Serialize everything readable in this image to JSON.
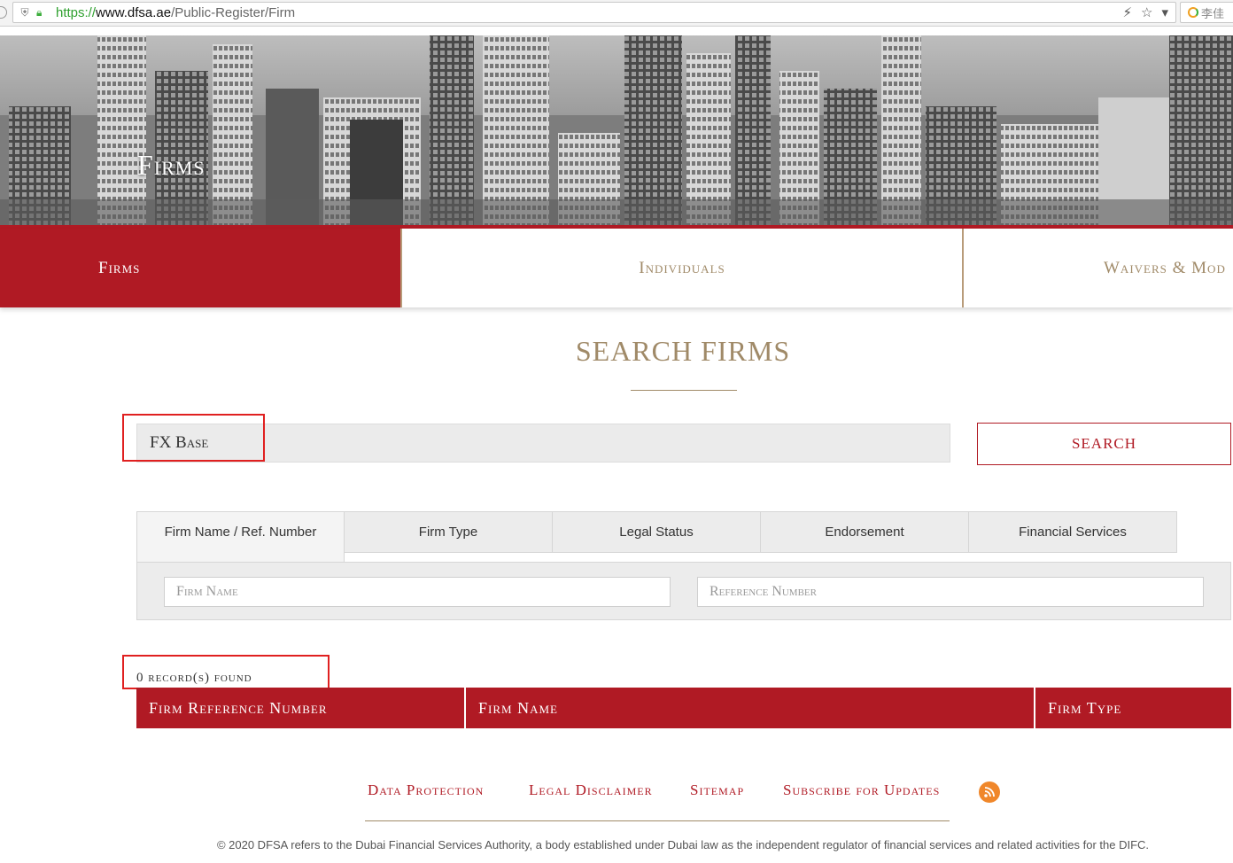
{
  "browser": {
    "url_scheme": "https://",
    "url_host": "www.dfsa.ae",
    "url_path": "/Public-Register/Firm",
    "profile_label": "李佳"
  },
  "hero": {
    "title": "Firms"
  },
  "category_tabs": [
    {
      "label": "Firms",
      "active": true
    },
    {
      "label": "Individuals",
      "active": false
    },
    {
      "label": "Waivers & Mod",
      "active": false
    }
  ],
  "search": {
    "heading": "SEARCH FIRMS",
    "query": "FX Base",
    "button_label": "SEARCH"
  },
  "filter_tabs": [
    {
      "label": "Firm Name / Ref. Number"
    },
    {
      "label": "Firm Type"
    },
    {
      "label": "Legal Status"
    },
    {
      "label": "Endorsement"
    },
    {
      "label": "Financial Services"
    }
  ],
  "filters": {
    "firm_name_placeholder": "Firm Name",
    "reference_number_placeholder": "Reference Number"
  },
  "results": {
    "records_found": "0 record(s) found",
    "columns": [
      "Firm Reference Number",
      "Firm Name",
      "Firm Type"
    ]
  },
  "footer": {
    "links": [
      "Data Protection",
      "Legal Disclaimer",
      "Sitemap",
      "Subscribe for Updates"
    ],
    "copyright": "© 2020 DFSA refers to the Dubai Financial Services Authority, a body established under Dubai law as the independent regulator of financial services and related activities for the DIFC."
  },
  "colors": {
    "brand_red": "#b01a24",
    "gold": "#a08a68",
    "rss_orange": "#f0872a"
  },
  "icons": [
    "shield-icon",
    "lock-icon",
    "lightning-icon",
    "star-icon",
    "dropdown-icon",
    "rss-icon"
  ]
}
